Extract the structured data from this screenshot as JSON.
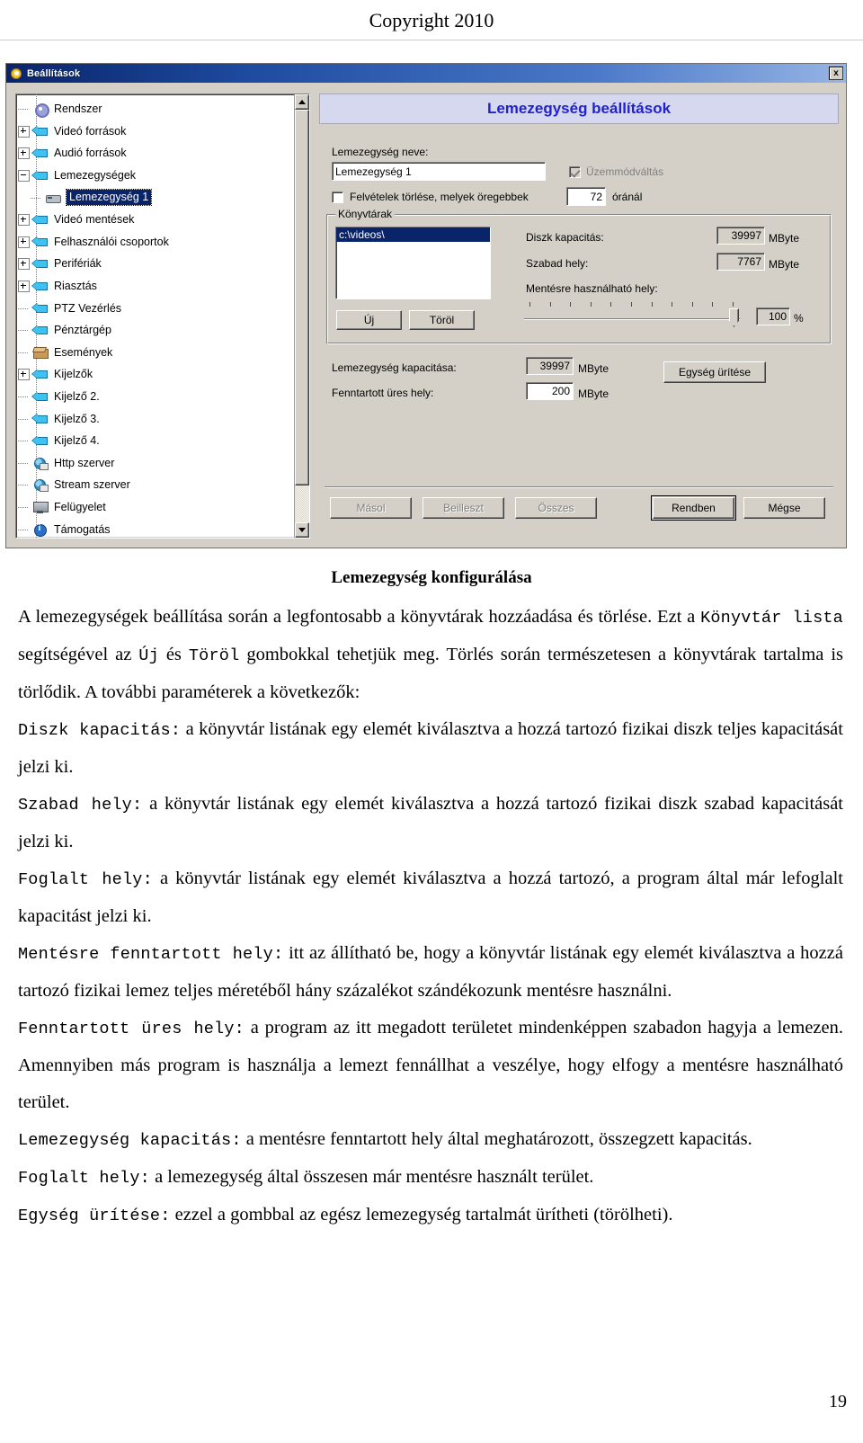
{
  "page": {
    "header": "Copyright 2010",
    "page_number": "19"
  },
  "dialog": {
    "title": "Beállítások",
    "close_label": "x",
    "banner_title": "Lemezegység beállítások",
    "tree": {
      "items": [
        {
          "label": "Rendszer",
          "icon": "gear-icon",
          "indent": 0,
          "expander": "none",
          "selected": false
        },
        {
          "label": "Videó források",
          "icon": "arrow-left-icon",
          "indent": 0,
          "expander": "plus",
          "selected": false
        },
        {
          "label": "Audió források",
          "icon": "arrow-left-icon",
          "indent": 0,
          "expander": "plus",
          "selected": false
        },
        {
          "label": "Lemezegységek",
          "icon": "arrow-left-icon",
          "indent": 0,
          "expander": "minus",
          "selected": false
        },
        {
          "label": "Lemezegység 1",
          "icon": "disk-drive-icon",
          "indent": 1,
          "expander": "none",
          "selected": true
        },
        {
          "label": "Videó mentések",
          "icon": "arrow-left-icon",
          "indent": 0,
          "expander": "plus",
          "selected": false
        },
        {
          "label": "Felhasználói csoportok",
          "icon": "arrow-left-icon",
          "indent": 0,
          "expander": "plus",
          "selected": false
        },
        {
          "label": "Perifériák",
          "icon": "arrow-left-icon",
          "indent": 0,
          "expander": "plus",
          "selected": false
        },
        {
          "label": "Riasztás",
          "icon": "arrow-left-icon",
          "indent": 0,
          "expander": "plus",
          "selected": false
        },
        {
          "label": "PTZ Vezérlés",
          "icon": "arrow-left-icon",
          "indent": 0,
          "expander": "none",
          "selected": false
        },
        {
          "label": "Pénztárgép",
          "icon": "arrow-left-icon",
          "indent": 0,
          "expander": "none",
          "selected": false
        },
        {
          "label": "Események",
          "icon": "box-icon",
          "indent": 0,
          "expander": "none",
          "selected": false
        },
        {
          "label": "Kijelzők",
          "icon": "arrow-left-icon",
          "indent": 0,
          "expander": "plus",
          "selected": false
        },
        {
          "label": "Kijelző 2.",
          "icon": "arrow-left-icon",
          "indent": 0,
          "expander": "none",
          "selected": false
        },
        {
          "label": "Kijelző 3.",
          "icon": "arrow-left-icon",
          "indent": 0,
          "expander": "none",
          "selected": false
        },
        {
          "label": "Kijelző 4.",
          "icon": "arrow-left-icon",
          "indent": 0,
          "expander": "none",
          "selected": false
        },
        {
          "label": "Http szerver",
          "icon": "globe-icon",
          "indent": 0,
          "expander": "none",
          "selected": false
        },
        {
          "label": "Stream szerver",
          "icon": "globe-icon",
          "indent": 0,
          "expander": "none",
          "selected": false
        },
        {
          "label": "Felügyelet",
          "icon": "monitor-icon",
          "indent": 0,
          "expander": "none",
          "selected": false
        },
        {
          "label": "Támogatás",
          "icon": "info-icon",
          "indent": 0,
          "expander": "none",
          "selected": false
        }
      ]
    },
    "form": {
      "drive_name_label": "Lemezegység neve:",
      "drive_name_value": "Lemezegység 1",
      "mode_switch_label": "Üzemmódváltás",
      "mode_switch_checked": true,
      "delete_older_label": "Felvételek törlése, melyek öregebbek",
      "delete_older_checked": false,
      "delete_older_hours": "72",
      "hours_unit": "óránál",
      "dirs_group_title": "Könyvtárak",
      "dirs_list": [
        "c:\\videos\\"
      ],
      "new_button": "Új",
      "delete_button": "Töröl",
      "disk_capacity_label": "Diszk kapacitás:",
      "disk_capacity_value": "39997",
      "free_space_label": "Szabad hely:",
      "free_space_value": "7767",
      "usable_space_label": "Mentésre használható hely:",
      "usable_space_percent": "100",
      "percent_unit": "%",
      "mbyte_unit": "MByte",
      "drive_capacity_label": "Lemezegység kapacitása:",
      "drive_capacity_value": "39997",
      "reserved_free_label": "Fenntartott üres hely:",
      "reserved_free_value": "200",
      "empty_drive_button": "Egység ürítése"
    },
    "footer": {
      "copy_button": "Másol",
      "paste_button": "Beilleszt",
      "all_button": "Összes",
      "ok_button": "Rendben",
      "cancel_button": "Mégse"
    }
  },
  "doc": {
    "title": "Lemezegység konfigurálása",
    "p1_a": "A lemezegységek beállítása során a legfontosabb a könyvtárak hozzáadása és törlése. Ezt a ",
    "p1_m1": "Könyvtár lista",
    "p1_b": " segítségével az ",
    "p1_m2": "Új",
    "p1_c": " és ",
    "p1_m3": "Töröl",
    "p1_d": " gombokkal tehetjük meg. Törlés során természetesen a könyvtárak tartalma is törlődik. A további paraméterek a következők:",
    "p2_m": "Diszk kapacitás:",
    "p2_t": " a könyvtár listának egy elemét kiválasztva a hozzá tartozó fizikai diszk teljes kapacitását jelzi ki.",
    "p3_m": "Szabad hely:",
    "p3_t": " a könyvtár listának egy elemét kiválasztva a hozzá tartozó fizikai diszk szabad kapacitását jelzi ki.",
    "p4_m": "Foglalt hely:",
    "p4_t": " a könyvtár listának egy elemét kiválasztva a hozzá tartozó, a program által már lefoglalt kapacitást jelzi ki.",
    "p5_m": "Mentésre fenntartott hely:",
    "p5_t": " itt az állítható be, hogy a könyvtár listának egy elemét kiválasztva a hozzá tartozó fizikai lemez teljes méretéből hány százalékot szándékozunk mentésre használni.",
    "p6_m": "Fenntartott üres hely:",
    "p6_t": " a program az itt megadott területet mindenképpen szabadon hagyja a lemezen. Amennyiben más program is használja a lemezt fennállhat a veszélye, hogy elfogy a mentésre használható terület.",
    "p7_m": "Lemezegység kapacitás:",
    "p7_t": "  a mentésre fenntartott hely által meghatározott, összegzett kapacitás.",
    "p8_m": "Foglalt hely:",
    "p8_t": "  a lemezegység által összesen már mentésre használt terület.",
    "p9_m": "Egység ürítése:",
    "p9_t": "  ezzel a gombbal az egész lemezegység tartalmát ürítheti (törölheti)."
  }
}
